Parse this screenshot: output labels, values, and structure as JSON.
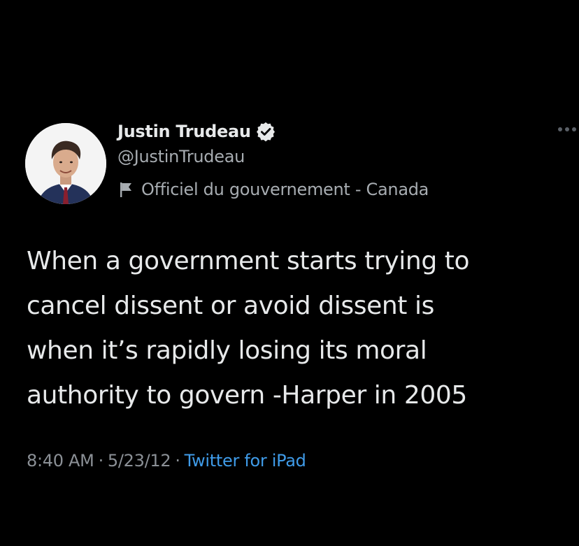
{
  "tweet": {
    "author": {
      "display_name": "Justin Trudeau",
      "handle": "@JustinTrudeau",
      "label": "Officiel du gouvernement - Canada",
      "verified": true
    },
    "text": "When a government starts trying to\ncancel dissent or avoid dissent is\nwhen it’s rapidly losing its moral\nauthority to govern -Harper in 2005",
    "time": "8:40 AM",
    "separator": "·",
    "date": "5/23/12",
    "source": "Twitter for iPad"
  },
  "icons": {
    "verified": "verified-badge-icon",
    "label": "flag-icon",
    "more": "more-options-icon"
  },
  "colors": {
    "background": "#000000",
    "primary_text": "#e7e9ea",
    "secondary_text": "#a7acb1",
    "link": "#3f9be8"
  }
}
